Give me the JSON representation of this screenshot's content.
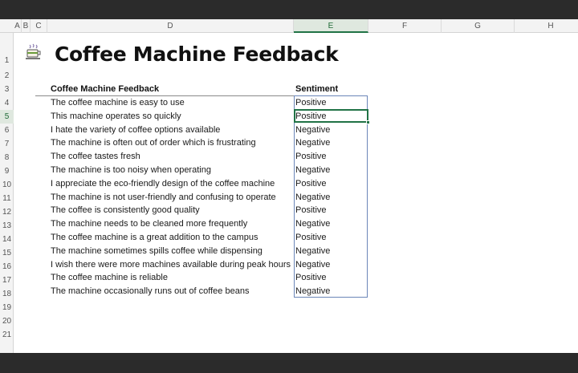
{
  "columns": [
    "A",
    "B",
    "C",
    "D",
    "E",
    "F",
    "G",
    "H"
  ],
  "selected_column": "E",
  "rows": [
    "1",
    "2",
    "3",
    "4",
    "5",
    "6",
    "7",
    "8",
    "9",
    "10",
    "11",
    "12",
    "13",
    "14",
    "15",
    "16",
    "17",
    "18",
    "19",
    "20",
    "21"
  ],
  "selected_row": "5",
  "title": "Coffee Machine Feedback",
  "title_icon": "coffee-cup-icon",
  "table": {
    "header_feedback": "Coffee Machine Feedback",
    "header_sentiment": "Sentiment",
    "rows": [
      {
        "feedback": "The coffee machine is easy to use",
        "sentiment": "Positive"
      },
      {
        "feedback": "This machine operates so quickly",
        "sentiment": "Positive"
      },
      {
        "feedback": "I hate the variety of coffee options available",
        "sentiment": "Negative"
      },
      {
        "feedback": "The machine is often out of order which is frustrating",
        "sentiment": "Negative"
      },
      {
        "feedback": "The coffee tastes fresh",
        "sentiment": "Positive"
      },
      {
        "feedback": "The machine is too noisy when operating",
        "sentiment": "Negative"
      },
      {
        "feedback": "I appreciate the eco-friendly design of the coffee machine",
        "sentiment": "Positive"
      },
      {
        "feedback": "The machine is not user-friendly and confusing to operate",
        "sentiment": "Negative"
      },
      {
        "feedback": "The coffee is consistently good quality",
        "sentiment": "Positive"
      },
      {
        "feedback": "The machine needs to be cleaned more frequently",
        "sentiment": "Negative"
      },
      {
        "feedback": "The coffee machine is a great addition to the campus",
        "sentiment": "Positive"
      },
      {
        "feedback": "The machine sometimes spills coffee while dispensing",
        "sentiment": "Negative"
      },
      {
        "feedback": "I wish there were more machines available during peak hours",
        "sentiment": "Negative"
      },
      {
        "feedback": "The coffee machine is reliable",
        "sentiment": "Positive"
      },
      {
        "feedback": "The machine occasionally runs out of coffee beans",
        "sentiment": "Negative"
      }
    ]
  },
  "colors": {
    "accent": "#217346",
    "selection_border": "#6b86b8"
  }
}
